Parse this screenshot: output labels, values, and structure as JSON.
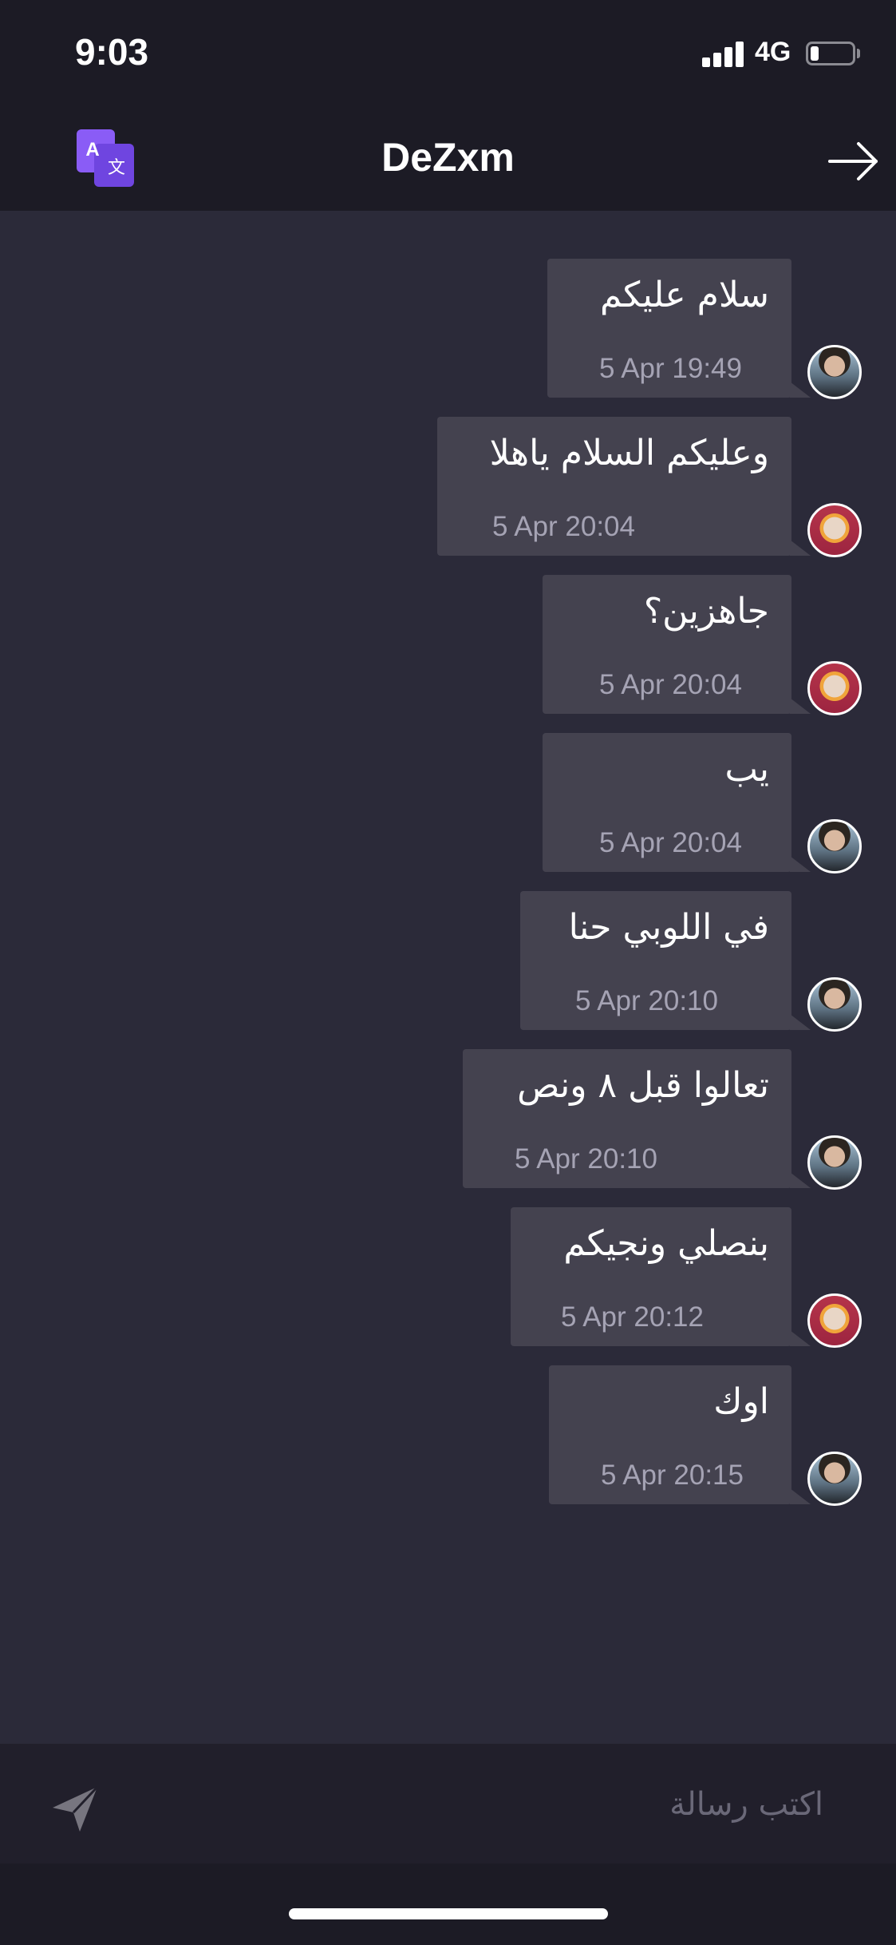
{
  "status_bar": {
    "time": "9:03",
    "network": "4G",
    "battery_level": 0.2
  },
  "nav": {
    "title": "DeZxm",
    "left_icon": "translate-icon",
    "right_icon": "arrow-right-icon"
  },
  "messages": [
    {
      "text": "سلام عليكم",
      "time": "5 Apr 19:49",
      "sender": "male"
    },
    {
      "text": "وعليكم السلام ياهلا",
      "time": "5 Apr 20:04",
      "sender": "female"
    },
    {
      "text": "جاهزين؟",
      "time": "5 Apr 20:04",
      "sender": "female"
    },
    {
      "text": "يب",
      "time": "5 Apr 20:04",
      "sender": "male"
    },
    {
      "text": "في اللوبي حنا",
      "time": "5 Apr 20:10",
      "sender": "male"
    },
    {
      "text": "تعالوا قبل ٨ ونص",
      "time": "5 Apr 20:10",
      "sender": "male"
    },
    {
      "text": "بنصلي ونجيكم",
      "time": "5 Apr 20:12",
      "sender": "female"
    },
    {
      "text": "اوك",
      "time": "5 Apr 20:15",
      "sender": "male"
    }
  ],
  "composer": {
    "placeholder": "اكتب رسالة",
    "value": "",
    "send_icon": "send-icon"
  },
  "colors": {
    "background": "#2b2a39",
    "bars": "#1c1b25",
    "bubble": "#44424f",
    "timestamp": "#a5a3b4",
    "accent": "#8a5cf6"
  }
}
